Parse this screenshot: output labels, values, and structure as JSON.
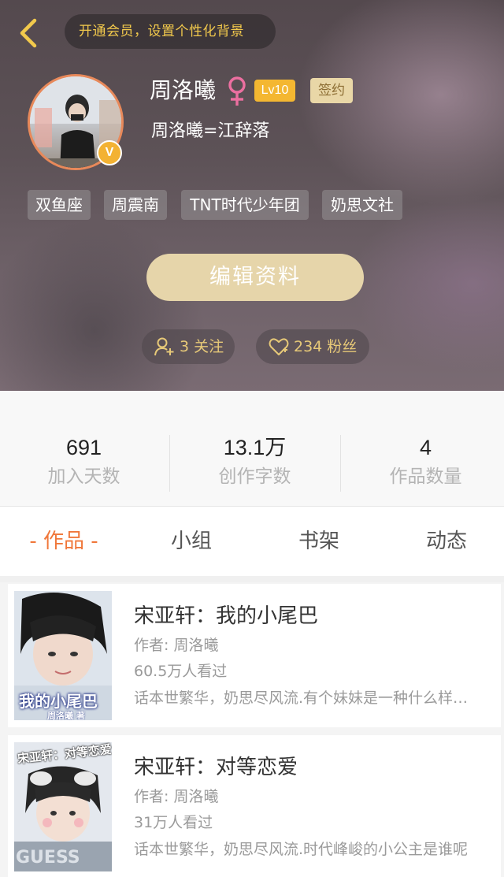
{
  "header": {
    "vip_banner": "开通会员，设置个性化背景",
    "name": "周洛曦",
    "level": "Lv10",
    "sign_badge": "签约",
    "subtitle": "周洛曦=江辞落",
    "verify_badge": "V",
    "tags": [
      "双鱼座",
      "周震南",
      "TNT时代少年团",
      "奶思文社"
    ],
    "edit_button": "编辑资料",
    "following": "3 关注",
    "fans": "234 粉丝"
  },
  "stats": [
    {
      "value": "691",
      "label": "加入天数"
    },
    {
      "value": "13.1万",
      "label": "创作字数"
    },
    {
      "value": "4",
      "label": "作品数量"
    }
  ],
  "tabs": [
    "- 作品 -",
    "小组",
    "书架",
    "动态"
  ],
  "works": [
    {
      "title": "宋亚轩：我的小尾巴",
      "author": "作者: 周洛曦",
      "views": "60.5万人看过",
      "desc": "话本世繁华，奶思尽风流.有个妹妹是一种什么样的体验",
      "cover_text": "我的小尾巴",
      "cover_sub": "周洛曦 著"
    },
    {
      "title": "宋亚轩：对等恋爱",
      "author": "作者: 周洛曦",
      "views": "31万人看过",
      "desc": "话本世繁华，奶思尽风流.时代峰峻的小公主是谁呢",
      "cover_text": "宋亚轩：对等恋爱",
      "cover_sub": "GUESS"
    }
  ],
  "colors": {
    "accent": "#f0773a",
    "gold": "#f2c94c",
    "level": "#f4b731",
    "edit_button": "#e6d5aa"
  },
  "icons": [
    "back-arrow-icon",
    "female-icon",
    "add-user-icon",
    "heart-icon"
  ]
}
